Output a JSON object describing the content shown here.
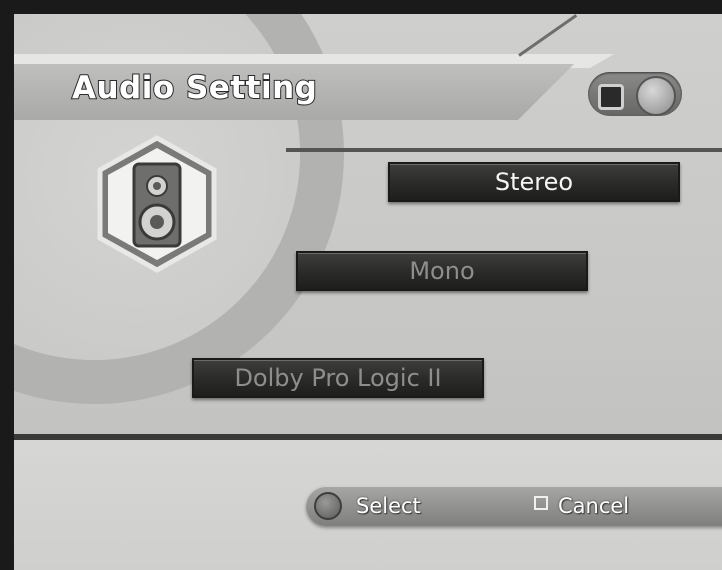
{
  "header": {
    "title": "Audio Setting"
  },
  "audio_options": {
    "stereo": "Stereo",
    "mono": "Mono",
    "dolby": "Dolby Pro Logic II",
    "selected": "Stereo"
  },
  "button_bar": {
    "select_label": "Select",
    "cancel_label": "Cancel"
  },
  "icons": {
    "section_icon": "speaker-icon",
    "toggle_icon": "controller-toggle-icon",
    "select_icon": "circle-button-icon",
    "cancel_icon": "square-button-icon"
  }
}
